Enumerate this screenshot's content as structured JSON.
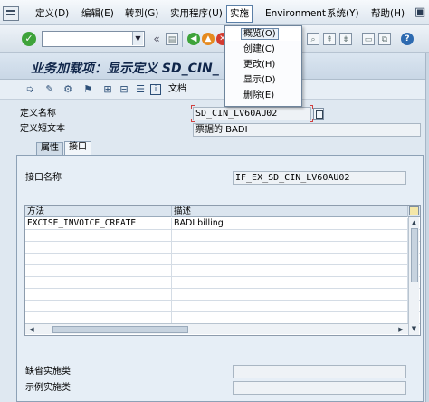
{
  "menubar": {
    "items": [
      "定义(D)",
      "编辑(E)",
      "转到(G)",
      "实用程序(U)",
      "实施",
      "Environment",
      "系统(Y)",
      "帮助(H)"
    ]
  },
  "toolbar": {
    "command_value": "",
    "command_placeholder": ""
  },
  "implement_menu": {
    "items": [
      "概览(O)",
      "创建(C)",
      "更改(H)",
      "显示(D)",
      "删除(E)"
    ]
  },
  "title": {
    "text": "业务加载项：显示定义 SD_CIN_"
  },
  "app_toolbar": {
    "doc_label": "文档"
  },
  "form": {
    "def_name_label": "定义名称",
    "def_name_value": "SD_CIN_LV60AU02",
    "short_text_label": "定义短文本",
    "short_text_value": "票据的 BADI",
    "interface_name_label": "接口名称",
    "interface_name_value": "IF_EX_SD_CIN_LV60AU02",
    "default_impl_label": "缺省实施类",
    "default_impl_value": "",
    "example_impl_label": "示例实施类",
    "example_impl_value": ""
  },
  "tabs": [
    {
      "label": "属性"
    },
    {
      "label": "接口"
    }
  ],
  "methods_table": {
    "headers": [
      "方法",
      "描述"
    ],
    "rows": [
      {
        "method": "EXCISE_INVOICE_CREATE",
        "description": "BADI billing"
      }
    ]
  }
}
